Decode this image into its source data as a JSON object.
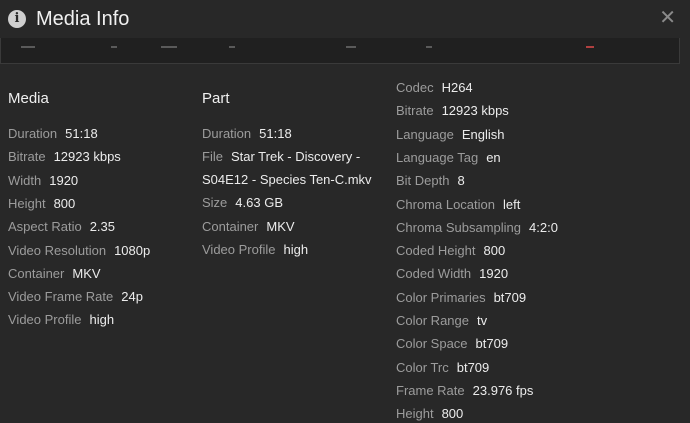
{
  "dialog": {
    "title": "Media Info",
    "icon": "info-icon",
    "close_glyph": "✕"
  },
  "media": {
    "heading": "Media",
    "rows": [
      {
        "label": "Duration",
        "value": "51:18"
      },
      {
        "label": "Bitrate",
        "value": "12923 kbps"
      },
      {
        "label": "Width",
        "value": "1920"
      },
      {
        "label": "Height",
        "value": "800"
      },
      {
        "label": "Aspect Ratio",
        "value": "2.35"
      },
      {
        "label": "Video Resolution",
        "value": "1080p"
      },
      {
        "label": "Container",
        "value": "MKV"
      },
      {
        "label": "Video Frame Rate",
        "value": "24p"
      },
      {
        "label": "Video Profile",
        "value": "high"
      }
    ]
  },
  "part": {
    "heading": "Part",
    "duration": {
      "label": "Duration",
      "value": "51:18"
    },
    "file": {
      "label": "File",
      "value_line1": "Star Trek - Discovery -",
      "value_line2": "S04E12 - Species Ten-C.mkv"
    },
    "size": {
      "label": "Size",
      "value": "4.63 GB"
    },
    "container": {
      "label": "Container",
      "value": "MKV"
    },
    "video_profile": {
      "label": "Video Profile",
      "value": "high"
    }
  },
  "stream": {
    "rows": [
      {
        "label": "Codec",
        "value": "H264"
      },
      {
        "label": "Bitrate",
        "value": "12923 kbps"
      },
      {
        "label": "Language",
        "value": "English"
      },
      {
        "label": "Language Tag",
        "value": "en"
      },
      {
        "label": "Bit Depth",
        "value": "8"
      },
      {
        "label": "Chroma Location",
        "value": "left"
      },
      {
        "label": "Chroma Subsampling",
        "value": "4:2:0"
      },
      {
        "label": "Coded Height",
        "value": "800"
      },
      {
        "label": "Coded Width",
        "value": "1920"
      },
      {
        "label": "Color Primaries",
        "value": "bt709"
      },
      {
        "label": "Color Range",
        "value": "tv"
      },
      {
        "label": "Color Space",
        "value": "bt709"
      },
      {
        "label": "Color Trc",
        "value": "bt709"
      },
      {
        "label": "Frame Rate",
        "value": "23.976 fps"
      },
      {
        "label": "Height",
        "value": "800"
      }
    ]
  }
}
